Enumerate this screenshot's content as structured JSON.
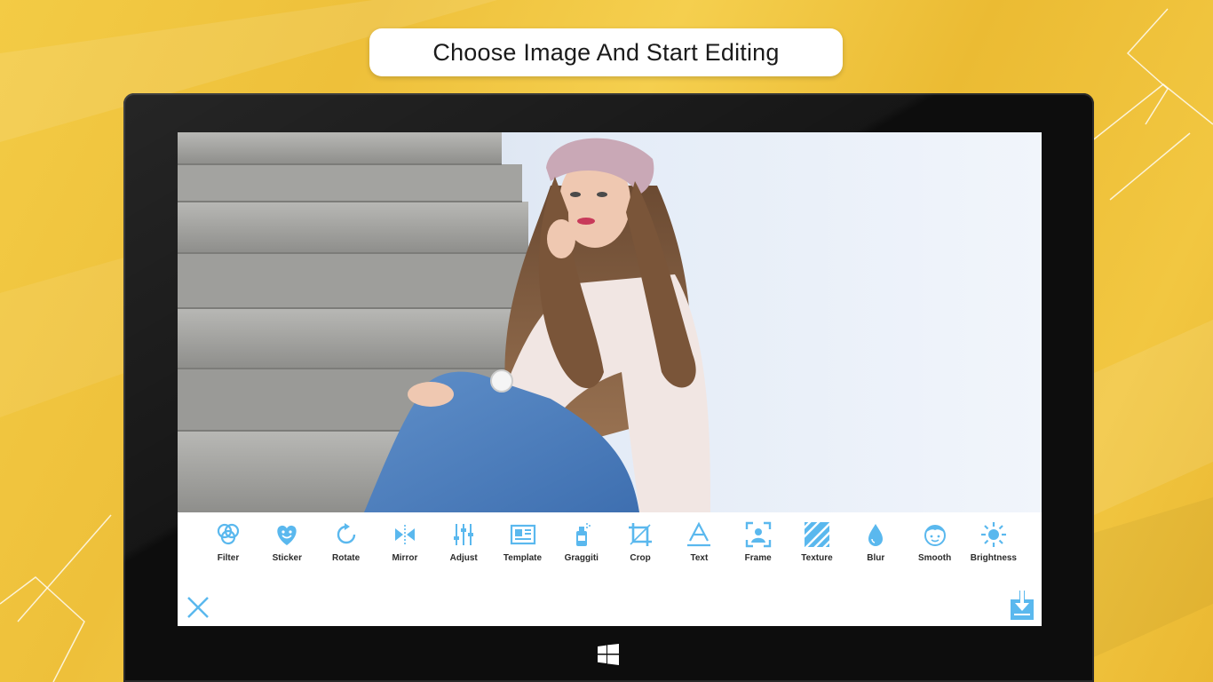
{
  "banner": {
    "title": "Choose Image And Start Editing"
  },
  "colors": {
    "accent": "#5ab8ee",
    "background": "#f0c33f",
    "bezel": "#0d0d0d"
  },
  "toolbar": {
    "tools": [
      {
        "label": "Filter",
        "icon": "filter-icon"
      },
      {
        "label": "Sticker",
        "icon": "sticker-icon"
      },
      {
        "label": "Rotate",
        "icon": "rotate-icon"
      },
      {
        "label": "Mirror",
        "icon": "mirror-icon"
      },
      {
        "label": "Adjust",
        "icon": "adjust-icon"
      },
      {
        "label": "Template",
        "icon": "template-icon"
      },
      {
        "label": "Graggiti",
        "icon": "spray-can-icon"
      },
      {
        "label": "Crop",
        "icon": "crop-icon"
      },
      {
        "label": "Text",
        "icon": "text-icon"
      },
      {
        "label": "Frame",
        "icon": "frame-icon"
      },
      {
        "label": "Texture",
        "icon": "texture-icon"
      },
      {
        "label": "Blur",
        "icon": "blur-drop-icon"
      },
      {
        "label": "Smooth",
        "icon": "smooth-face-icon"
      },
      {
        "label": "Brightness",
        "icon": "brightness-sun-icon"
      }
    ]
  },
  "actions": {
    "close_icon": "close-icon",
    "save_icon": "save-download-icon"
  }
}
